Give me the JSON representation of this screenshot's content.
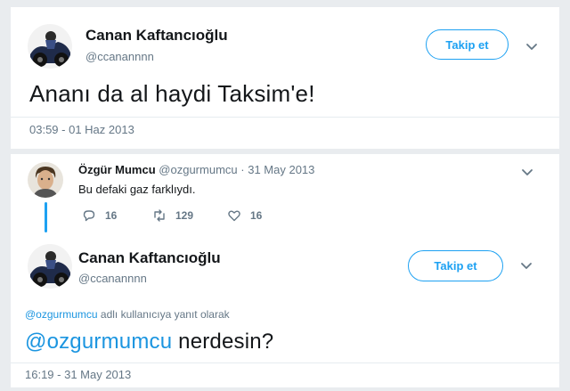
{
  "tweet_main": {
    "name": "Canan Kaftancıoğlu",
    "handle": "@ccanannnn",
    "follow_label": "Takip et",
    "text": "Ananı da al haydi Taksim'e!",
    "timestamp": "03:59 - 01 Haz 2013"
  },
  "reply_thread": {
    "parent": {
      "name": "Özgür Mumcu",
      "handle": "@ozgurmumcu",
      "separator": "·",
      "date": "31 May 2013",
      "text": "Bu defaki gaz farklıydı.",
      "stats": {
        "replies": "16",
        "retweets": "129",
        "likes": "16"
      }
    },
    "reply": {
      "name": "Canan Kaftancıoğlu",
      "handle": "@ccanannnn",
      "follow_label": "Takip et",
      "replying_to_mention": "@ozgurmumcu",
      "replying_to_suffix": "adlı kullanıcıya yanıt olarak",
      "text_mention": "@ozgurmumcu",
      "text_rest": " nerdesin?",
      "timestamp": "16:19 - 31 May 2013"
    }
  },
  "colors": {
    "accent": "#1da1f2",
    "mention": "#1b95e0",
    "secondary_text": "#657786",
    "background": "#e9ecef"
  },
  "icons": [
    "chevron-down-icon",
    "reply-icon",
    "retweet-icon",
    "like-icon"
  ]
}
